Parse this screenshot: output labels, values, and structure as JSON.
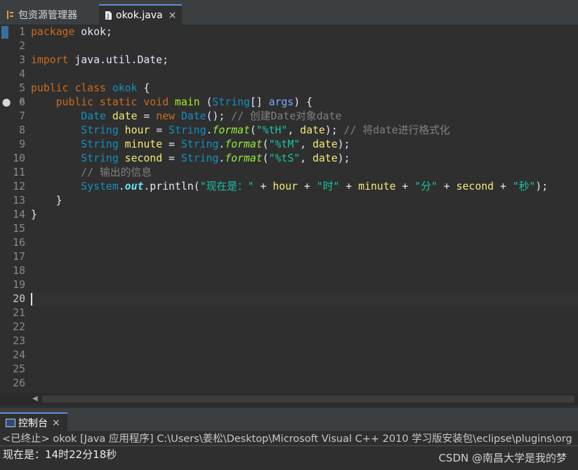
{
  "tabs": {
    "package_explorer": "包资源管理器",
    "editor_file": "okok.java",
    "close_glyph": "×"
  },
  "editor": {
    "line_numbers": [
      "1",
      "2",
      "3",
      "4",
      "5",
      "6",
      "7",
      "8",
      "9",
      "10",
      "11",
      "12",
      "13",
      "14",
      "15",
      "16",
      "17",
      "18",
      "19",
      "20",
      "21",
      "22",
      "23",
      "24",
      "25",
      "26"
    ],
    "current_line": 20,
    "code": [
      [
        {
          "c": "k",
          "x": "package"
        },
        {
          "c": "w",
          "x": " okok;"
        }
      ],
      [],
      [
        {
          "c": "k",
          "x": "import"
        },
        {
          "c": "w",
          "x": " java.util.Date;"
        }
      ],
      [],
      [
        {
          "c": "k",
          "x": "public class"
        },
        {
          "c": "w",
          "x": " "
        },
        {
          "c": "t",
          "x": "okok"
        },
        {
          "c": "w",
          "x": " {"
        }
      ],
      [
        {
          "c": "w",
          "x": "    "
        },
        {
          "c": "k",
          "x": "public static void"
        },
        {
          "c": "w",
          "x": " "
        },
        {
          "c": "m",
          "x": "main"
        },
        {
          "c": "w",
          "x": " ("
        },
        {
          "c": "t",
          "x": "String"
        },
        {
          "c": "w",
          "x": "[] "
        },
        {
          "c": "p",
          "x": "args"
        },
        {
          "c": "w",
          "x": ") {"
        }
      ],
      [
        {
          "c": "w",
          "x": "        "
        },
        {
          "c": "t",
          "x": "Date"
        },
        {
          "c": "w",
          "x": " "
        },
        {
          "c": "v",
          "x": "date"
        },
        {
          "c": "w",
          "x": " = "
        },
        {
          "c": "k",
          "x": "new"
        },
        {
          "c": "w",
          "x": " "
        },
        {
          "c": "t",
          "x": "Date"
        },
        {
          "c": "w",
          "x": "(); "
        },
        {
          "c": "c",
          "x": "// 创建Date对象date"
        }
      ],
      [
        {
          "c": "w",
          "x": "        "
        },
        {
          "c": "t",
          "x": "String"
        },
        {
          "c": "w",
          "x": " "
        },
        {
          "c": "v",
          "x": "hour"
        },
        {
          "c": "w",
          "x": " = "
        },
        {
          "c": "t",
          "x": "String"
        },
        {
          "c": "w",
          "x": "."
        },
        {
          "c": "f",
          "x": "format"
        },
        {
          "c": "w",
          "x": "("
        },
        {
          "c": "s",
          "x": "\"%tH\""
        },
        {
          "c": "w",
          "x": ", "
        },
        {
          "c": "v",
          "x": "date"
        },
        {
          "c": "w",
          "x": "); "
        },
        {
          "c": "c",
          "x": "// 将date进行格式化"
        }
      ],
      [
        {
          "c": "w",
          "x": "        "
        },
        {
          "c": "t",
          "x": "String"
        },
        {
          "c": "w",
          "x": " "
        },
        {
          "c": "v",
          "x": "minute"
        },
        {
          "c": "w",
          "x": " = "
        },
        {
          "c": "t",
          "x": "String"
        },
        {
          "c": "w",
          "x": "."
        },
        {
          "c": "f",
          "x": "format"
        },
        {
          "c": "w",
          "x": "("
        },
        {
          "c": "s",
          "x": "\"%tM\""
        },
        {
          "c": "w",
          "x": ", "
        },
        {
          "c": "v",
          "x": "date"
        },
        {
          "c": "w",
          "x": ");"
        }
      ],
      [
        {
          "c": "w",
          "x": "        "
        },
        {
          "c": "t",
          "x": "String"
        },
        {
          "c": "w",
          "x": " "
        },
        {
          "c": "v",
          "x": "second"
        },
        {
          "c": "w",
          "x": " = "
        },
        {
          "c": "t",
          "x": "String"
        },
        {
          "c": "w",
          "x": "."
        },
        {
          "c": "f",
          "x": "format"
        },
        {
          "c": "w",
          "x": "("
        },
        {
          "c": "s",
          "x": "\"%tS\""
        },
        {
          "c": "w",
          "x": ", "
        },
        {
          "c": "v",
          "x": "date"
        },
        {
          "c": "w",
          "x": ");"
        }
      ],
      [
        {
          "c": "w",
          "x": "        "
        },
        {
          "c": "c",
          "x": "// 输出的信息"
        }
      ],
      [
        {
          "c": "w",
          "x": "        "
        },
        {
          "c": "t",
          "x": "System"
        },
        {
          "c": "w",
          "x": "."
        },
        {
          "c": "o",
          "x": "out"
        },
        {
          "c": "w",
          "x": ".println("
        },
        {
          "c": "s",
          "x": "\"现在是：\""
        },
        {
          "c": "w",
          "x": " + "
        },
        {
          "c": "v",
          "x": "hour"
        },
        {
          "c": "w",
          "x": " + "
        },
        {
          "c": "s",
          "x": "\"时\""
        },
        {
          "c": "w",
          "x": " + "
        },
        {
          "c": "v",
          "x": "minute"
        },
        {
          "c": "w",
          "x": " + "
        },
        {
          "c": "s",
          "x": "\"分\""
        },
        {
          "c": "w",
          "x": " + "
        },
        {
          "c": "v",
          "x": "second"
        },
        {
          "c": "w",
          "x": " + "
        },
        {
          "c": "s",
          "x": "\"秒\""
        },
        {
          "c": "w",
          "x": ");"
        }
      ],
      [
        {
          "c": "w",
          "x": "    }"
        }
      ],
      [
        {
          "c": "w",
          "x": "}"
        }
      ],
      [],
      [],
      [],
      [],
      [],
      [],
      [],
      [],
      [],
      [],
      [],
      []
    ]
  },
  "console": {
    "tab_label": "控制台",
    "header": "<已终止> okok [Java 应用程序] C:\\Users\\姜松\\Desktop\\Microsoft Visual C++ 2010 学习版安装包\\eclipse\\plugins\\org",
    "output": "现在是：14时22分18秒"
  },
  "watermark": "CSDN @南昌大学是我的梦",
  "colors": {
    "background": "#2f2f2f",
    "keyword": "#cc6c1d",
    "type": "#1290c3",
    "string": "#17c6a3",
    "comment": "#808080",
    "variable": "#f3ec79",
    "tab_accent": "#5a8fd6"
  }
}
